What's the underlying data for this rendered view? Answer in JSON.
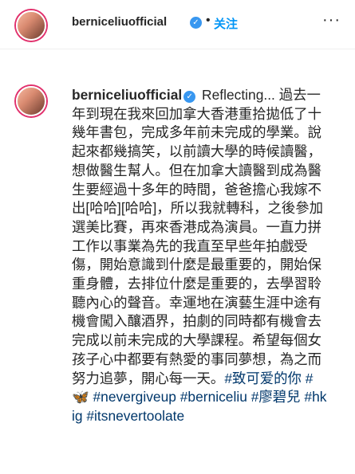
{
  "header": {
    "username": "berniceliuofficial",
    "verified_icon": "verified-badge-icon",
    "separator": "•",
    "follow_label": "关注",
    "more_icon": "more-options-icon"
  },
  "caption": {
    "username": "berniceliuofficial",
    "text": "Reflecting... 過去一年到現在我來回加拿大香港重拾拋低了十幾年書包，完成多年前未完成的學業。說起來都幾搞笑，以前讀大學的時候讀醫，想做醫生幫人。但在加拿大讀醫到成為醫生要經過十多年的時間，爸爸擔心我嫁不出[哈哈][哈哈]，所以我就轉科，之後參加選美比賽，再來香港成為演員。一直力拼工作以事業為先的我直至早些年拍戲受傷，開始意識到什麼是最重要的，開始保重身體，去排位什麼是重要的，去學習聆聽內心的聲音。幸運地在演藝生涯中途有機會闖入釀酒界，拍劇的同時都有機會去完成以前未完成的大學課程。希望每個女孩子心中都要有熱愛的事同夢想，為之而努力追夢，開心每一天。",
    "hashtags": [
      "#致可爱的你",
      "#",
      "#nevergiveup",
      "#berniceliu",
      "#廖碧兒",
      "#hkig",
      "#itsnevertoolate"
    ],
    "emoji": "🦋"
  },
  "colors": {
    "link": "#00376b",
    "follow": "#0095f6",
    "verified": "#3897f0"
  }
}
